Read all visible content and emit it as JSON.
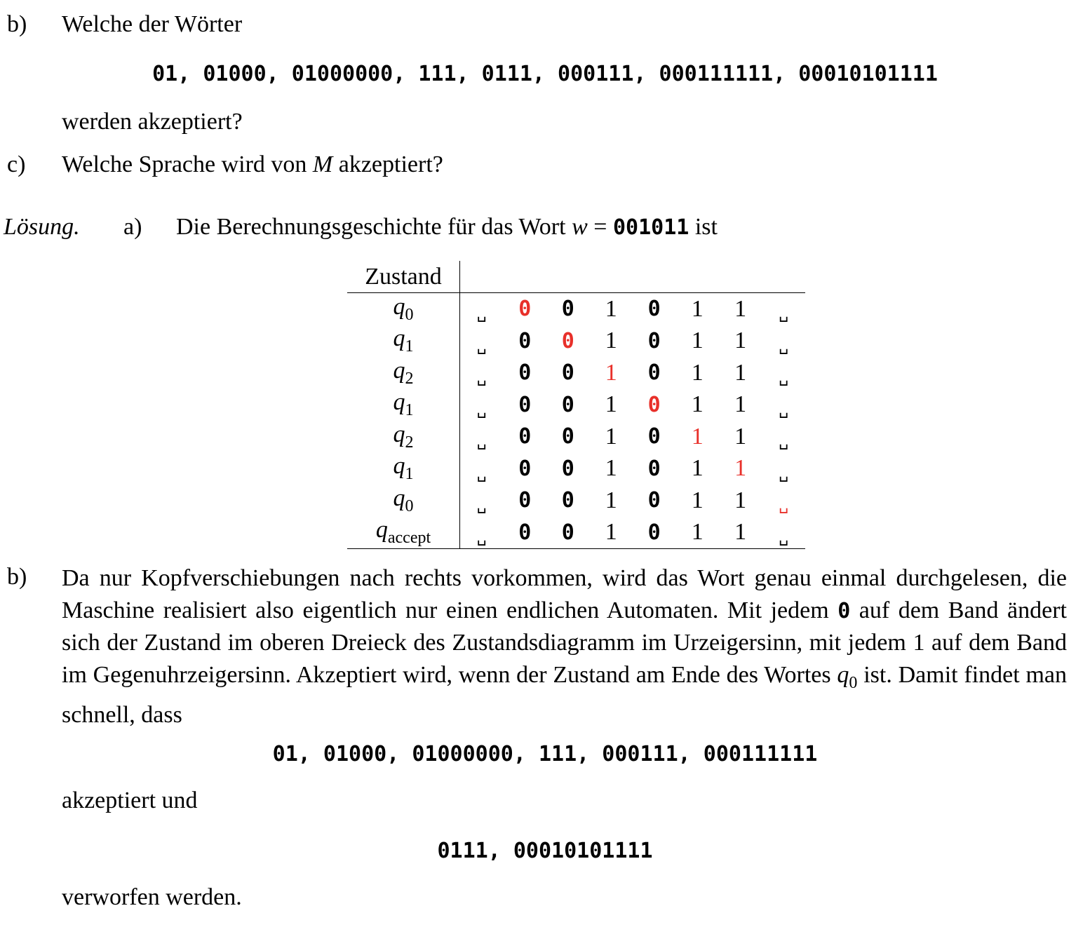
{
  "question_b": {
    "label": "b)",
    "text": "Welche der Wörter",
    "words": "01, 01000, 01000000, 111, 0111, 000111, 000111111, 00010101111",
    "after": "werden akzeptiert?"
  },
  "question_c": {
    "label": "c)",
    "text_before": "Welche Sprache wird von ",
    "var": "M",
    "text_after": " akzeptiert?"
  },
  "solution": {
    "label": "Lösung.",
    "a_label": "a)",
    "a_text": "Die Berechnungsgeschichte für das Wort ",
    "a_var": "w",
    "a_eq": " = ",
    "a_word": "001011",
    "a_end": " ist",
    "table": {
      "header": "Zustand",
      "rows": [
        {
          "state": "q",
          "sub": "0",
          "head": 1
        },
        {
          "state": "q",
          "sub": "1",
          "head": 2
        },
        {
          "state": "q",
          "sub": "2",
          "head": 3
        },
        {
          "state": "q",
          "sub": "1",
          "head": 4
        },
        {
          "state": "q",
          "sub": "2",
          "head": 5
        },
        {
          "state": "q",
          "sub": "1",
          "head": 6
        },
        {
          "state": "q",
          "sub": "0",
          "head": 7
        },
        {
          "state": "q",
          "sub": "accept",
          "head": -1
        }
      ],
      "tape": [
        "␣",
        "0",
        "0",
        "1",
        "0",
        "1",
        "1",
        "␣"
      ],
      "highlight_color": "#e8302a"
    },
    "b_label": "b)",
    "b_para_1": "Da nur Kopfverschiebungen nach rechts vorkommen, wird das Wort genau einmal durchgelesen, die Maschine realisiert also eigentlich nur einen endlichen Automaten. Mit jedem ",
    "b_para_zero": "0",
    "b_para_2": " auf dem Band ändert sich der Zustand im oberen Dreieck des Zustandsdiagramm im Urzeigersinn, mit jedem ",
    "b_para_one": "1",
    "b_para_3": " auf dem Band im Gegenuhrzeigersinn. Akzeptiert wird, wenn der Zustand am Ende des Wortes ",
    "b_para_q": "q",
    "b_para_q_sub": "0",
    "b_para_4": " ist. Damit findet man schnell, dass",
    "accepted_words": "01, 01000, 01000000, 111, 000111, 000111111",
    "accepted_text": "akzeptiert und",
    "rejected_words": "0111, 00010101111",
    "rejected_text": "verworfen werden."
  }
}
